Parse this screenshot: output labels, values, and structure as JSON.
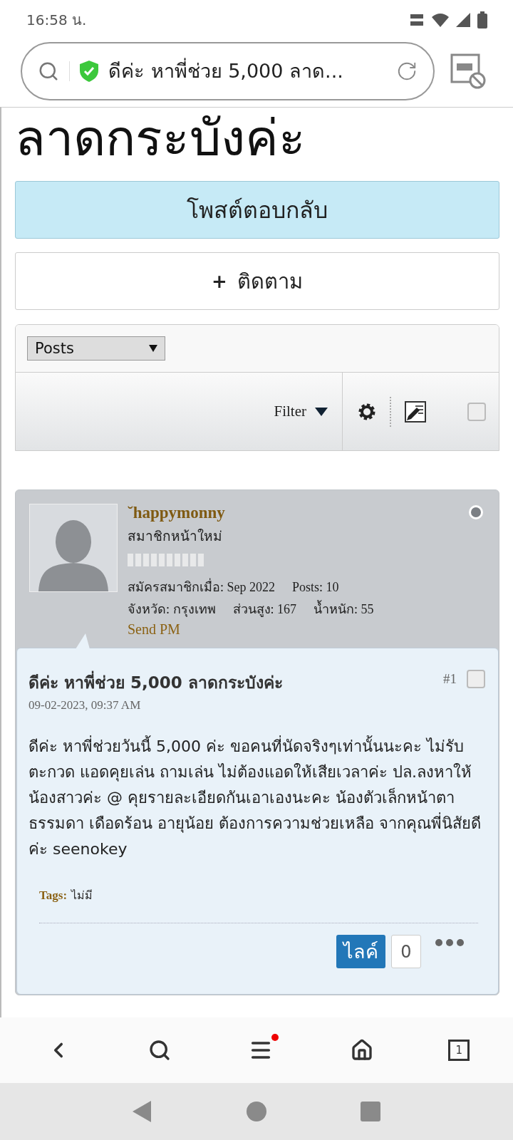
{
  "status_bar": {
    "time": "16:58 น."
  },
  "address_bar": {
    "title": "ดีค่ะ หาพี่ช่วย 5,000 ลาด...",
    "secure": true
  },
  "thread_title": "ลาดกระบังค่ะ",
  "reply_button": "โพสต์ตอบกลับ",
  "follow_button": {
    "icon": "+",
    "label": "ติดตาม"
  },
  "toolbar": {
    "view_select": "Posts",
    "filter": "Filter",
    "select_all_checked": false
  },
  "post": {
    "username": "˘happymonny",
    "online": false,
    "rank": "สมาชิกหน้าใหม่",
    "joined": "สมัครสมาชิกเมื่อ: Sep 2022",
    "posts": "Posts: 10",
    "province": "จังหวัด: กรุงเทพ",
    "height": "ส่วนสูง: 167",
    "weight": "น้ำหนัก: 55",
    "send_pm": "Send PM",
    "title": "ดีค่ะ หาพี่ช่วย 5,000 ลาดกระบังค่ะ",
    "number": "#1",
    "selected": false,
    "date": "09-02-2023, 09:37 AM",
    "body": "ดีค่ะ หาพี่ช่วยวันนี้ 5,000 ค่ะ ขอคนที่นัดจริงๆเท่านั้นนะคะ ไม่รับตะกวด แอดคุยเล่น ถามเล่น ไม่ต้องแอดให้เสียเวลาค่ะ ปล.ลงหาให้น้องสาวค่ะ @ คุยรายละเอียดกันเอาเองนะคะ น้องตัวเล็กหน้าตาธรรมดา เดือดร้อน อายุน้อย ต้องการความช่วยเหลือ จากคุณพี่นิสัยดีค่ะ seenokey",
    "tags_label": "Tags:",
    "tags": "ไม่มี",
    "like_button": "ไลค์",
    "like_count": "0"
  },
  "bottom_nav": {
    "menu_badge": true,
    "tab_count": "1"
  }
}
